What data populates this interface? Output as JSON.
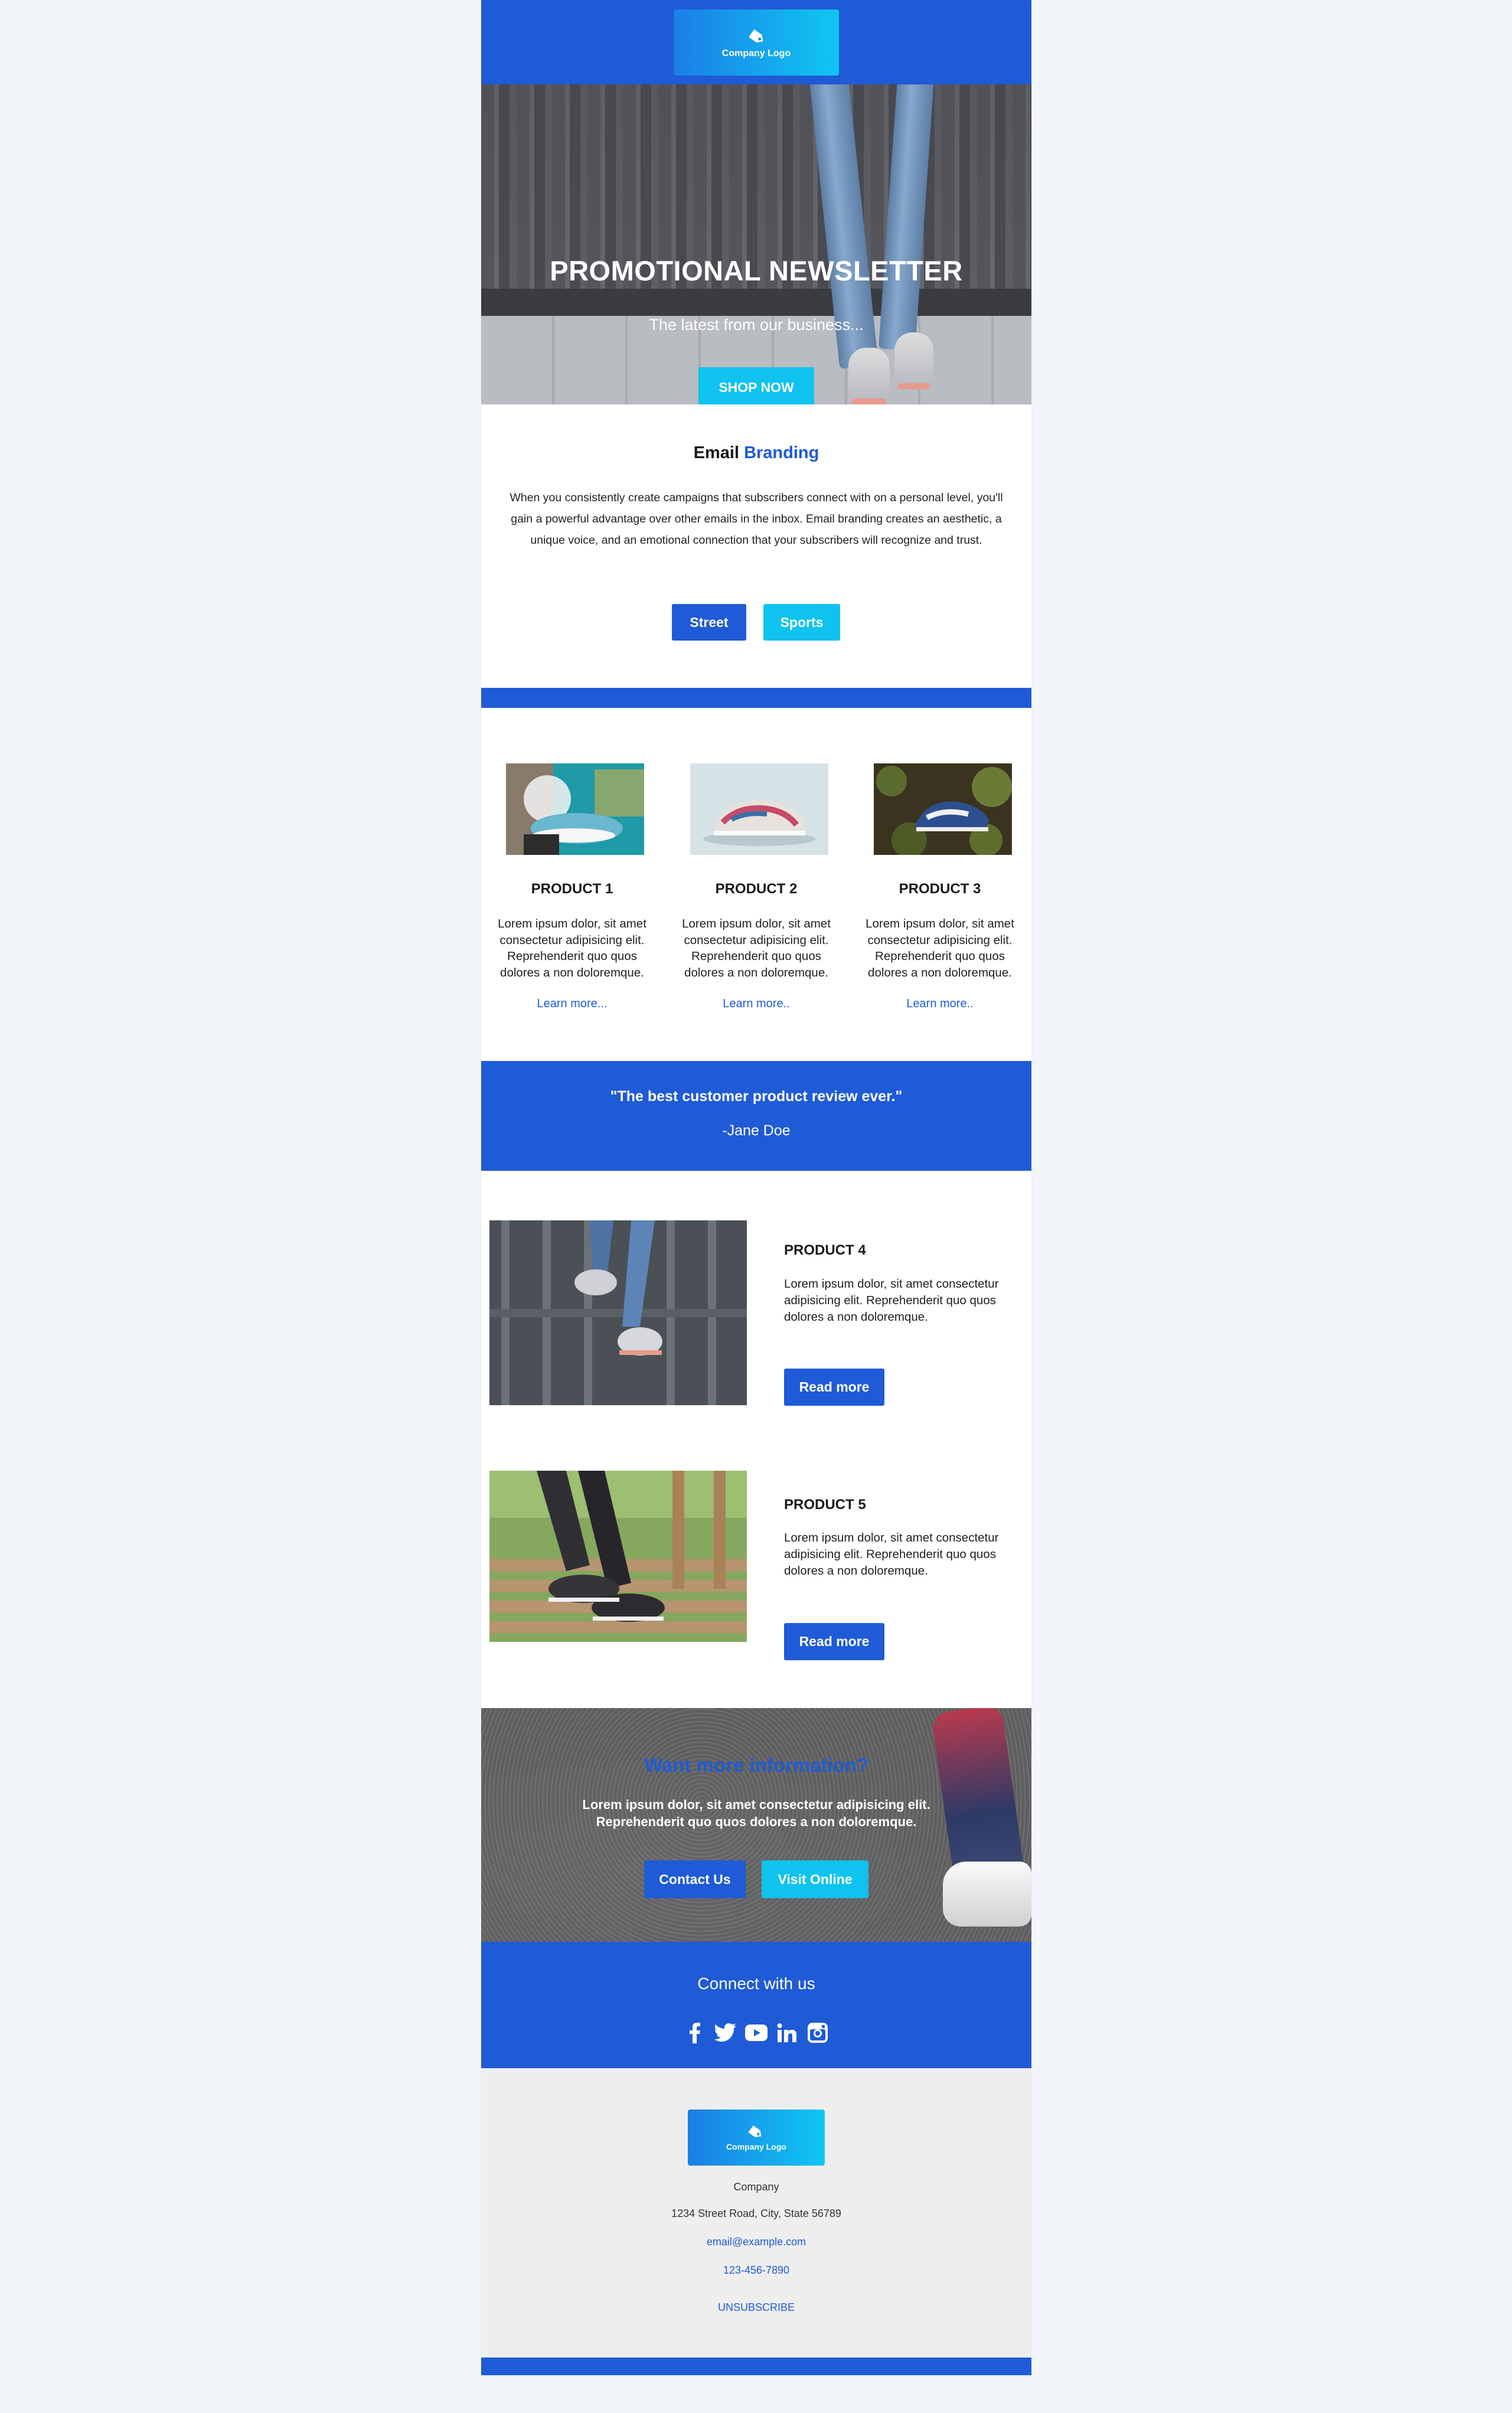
{
  "header": {
    "logo_text": "Company Logo"
  },
  "hero": {
    "title": "PROMOTIONAL NEWSLETTER",
    "subtitle": "The latest from our business...",
    "cta_label": "SHOP NOW"
  },
  "branding": {
    "title_part1": "Email",
    "title_part2": "Branding",
    "text": "When you consistently create campaigns that subscribers connect with on a personal level, you'll gain a powerful advantage over other emails in the inbox. Email branding creates an aesthetic, a unique voice, and an emotional connection that your subscribers will recognize and trust.",
    "buttons": [
      "Street",
      "Sports"
    ]
  },
  "products": [
    {
      "name": "PRODUCT 1",
      "desc": "Lorem ipsum dolor, sit amet consectetur adipisicing elit. Reprehenderit quo quos dolores a non doloremque.",
      "link": "Learn more..."
    },
    {
      "name": "PRODUCT 2",
      "desc": "Lorem ipsum dolor, sit amet consectetur adipisicing elit. Reprehenderit quo quos dolores a non doloremque.",
      "link": "Learn more.."
    },
    {
      "name": "PRODUCT 3",
      "desc": "Lorem ipsum dolor, sit amet consectetur adipisicing elit. Reprehenderit quo quos dolores a non doloremque.",
      "link": "Learn more.."
    }
  ],
  "quote": {
    "text": "\"The best customer product review ever.\"",
    "author": "-Jane Doe"
  },
  "features": [
    {
      "name": "PRODUCT 4",
      "desc": "Lorem ipsum dolor, sit amet consectetur adipisicing elit. Reprehenderit quo quos dolores a non doloremque.",
      "button": "Read more"
    },
    {
      "name": "PRODUCT 5",
      "desc": "Lorem ipsum dolor, sit amet consectetur adipisicing elit. Reprehenderit quo quos dolores a non doloremque.",
      "button": "Read more"
    }
  ],
  "cta": {
    "title": "Want more information?",
    "text": "Lorem ipsum dolor, sit amet consectetur adipisicing elit. Reprehenderit quo quos dolores a non doloremque.",
    "buttons": [
      "Contact Us",
      "Visit Online"
    ]
  },
  "connect": {
    "title": "Connect with us",
    "icons": [
      "facebook-icon",
      "twitter-icon",
      "youtube-icon",
      "linkedin-icon",
      "instagram-icon"
    ]
  },
  "footer": {
    "logo_text": "Company Logo",
    "company": "Company",
    "address": "1234 Street Road, City, State 56789",
    "email": "email@example.com",
    "phone": "123-456-7890",
    "unsubscribe": "UNSUBSCRIBE"
  },
  "colors": {
    "primary": "#1f5bd6",
    "accent": "#0fc3ee",
    "footer_bg": "#eeeeee",
    "page_bg": "#f2f6fa"
  }
}
